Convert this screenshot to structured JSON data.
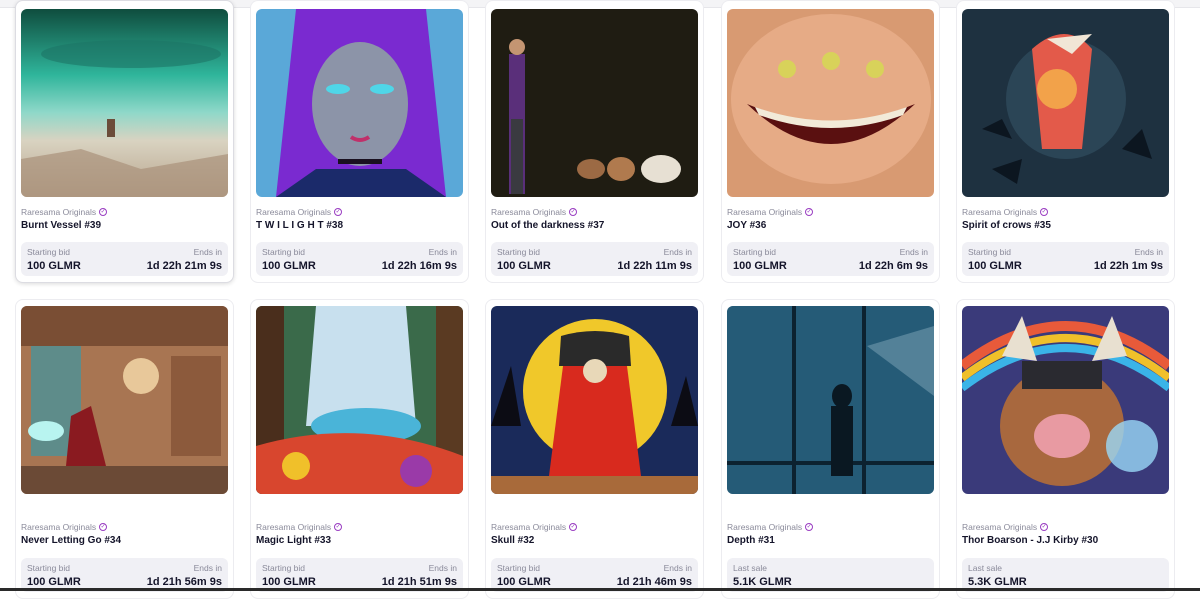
{
  "cards": [
    {
      "collection": "Raresama Originals",
      "title": "Burnt Vessel #39",
      "left_label": "Starting bid",
      "left_value": "100 GLMR",
      "right_label": "Ends in",
      "right_value": "1d 22h 21m 9s",
      "art": "burnt-vessel-artwork"
    },
    {
      "collection": "Raresama Originals",
      "title": "T W I L I G H T #38",
      "left_label": "Starting bid",
      "left_value": "100 GLMR",
      "right_label": "Ends in",
      "right_value": "1d 22h 16m 9s",
      "art": "twilight-artwork"
    },
    {
      "collection": "Raresama Originals",
      "title": "Out of the darkness #37",
      "left_label": "Starting bid",
      "left_value": "100 GLMR",
      "right_label": "Ends in",
      "right_value": "1d 22h 11m 9s",
      "art": "darkness-artwork"
    },
    {
      "collection": "Raresama Originals",
      "title": "JOY #36",
      "left_label": "Starting bid",
      "left_value": "100 GLMR",
      "right_label": "Ends in",
      "right_value": "1d 22h 6m 9s",
      "art": "joy-artwork"
    },
    {
      "collection": "Raresama Originals",
      "title": "Spirit of crows #35",
      "left_label": "Starting bid",
      "left_value": "100 GLMR",
      "right_label": "Ends in",
      "right_value": "1d 22h 1m 9s",
      "art": "crows-artwork"
    },
    {
      "collection": "Raresama Originals",
      "title": "Never Letting Go #34",
      "left_label": "Starting bid",
      "left_value": "100 GLMR",
      "right_label": "Ends in",
      "right_value": "1d 21h 56m 9s",
      "art": "witch-shop-artwork"
    },
    {
      "collection": "Raresama Originals",
      "title": "Magic Light #33",
      "left_label": "Starting bid",
      "left_value": "100 GLMR",
      "right_label": "Ends in",
      "right_value": "1d 21h 51m 9s",
      "art": "magic-light-artwork"
    },
    {
      "collection": "Raresama Originals",
      "title": "Skull #32",
      "left_label": "Starting bid",
      "left_value": "100 GLMR",
      "right_label": "Ends in",
      "right_value": "1d 21h 46m 9s",
      "art": "skull-artwork"
    },
    {
      "collection": "Raresama Originals",
      "title": "Depth #31",
      "left_label": "Last sale",
      "left_value": "5.1K GLMR",
      "right_label": "",
      "right_value": "",
      "art": "depth-artwork"
    },
    {
      "collection": "Raresama Originals",
      "title": "Thor Boarson - J.J Kirby #30",
      "left_label": "Last sale",
      "left_value": "5.3K GLMR",
      "right_label": "",
      "right_value": "",
      "art": "thor-boarson-artwork"
    }
  ],
  "colors": {
    "verified": "#9a3ec2",
    "panel": "#f0f0f5"
  }
}
